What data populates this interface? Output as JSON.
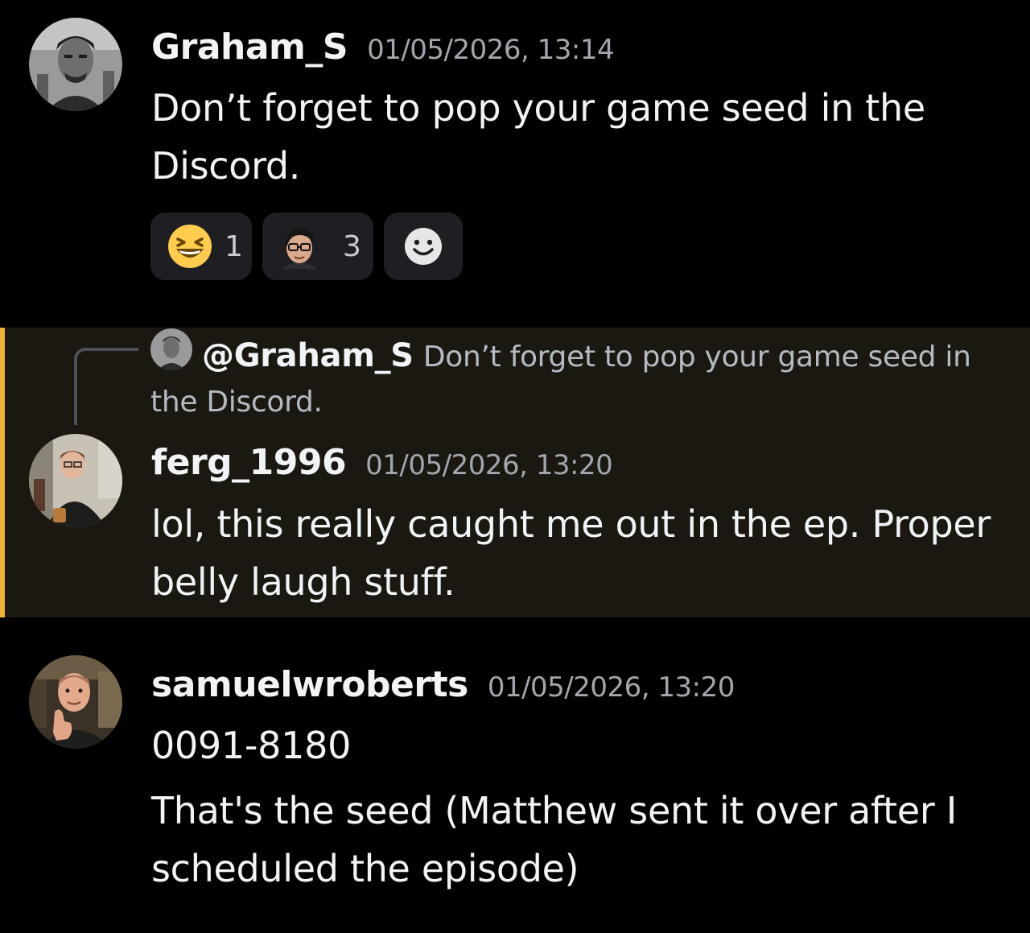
{
  "messages": [
    {
      "username": "Graham_S",
      "timestamp": "01/05/2026, 13:14",
      "text": "Don’t forget to pop your game seed in the Discord.",
      "reactions": [
        {
          "emoji": "laughing-face-emoji",
          "count": "1"
        },
        {
          "emoji": "custom-face-emoji",
          "count": "3"
        },
        {
          "emoji": "add-reaction-icon"
        }
      ]
    },
    {
      "reply": {
        "mention": "@Graham_S",
        "text": "Don’t forget to pop your game seed in the Discord."
      },
      "username": "ferg_1996",
      "timestamp": "01/05/2026, 13:20",
      "text": "lol, this really caught me out in the ep. Proper belly laugh stuff.",
      "highlighted": true,
      "highlight_color": "#f0b232"
    },
    {
      "username": "samuelwroberts",
      "timestamp": "01/05/2026, 13:20",
      "text_lines": [
        "0091-8180",
        "That's the seed (Matthew sent it over after I scheduled the episode)"
      ]
    }
  ]
}
